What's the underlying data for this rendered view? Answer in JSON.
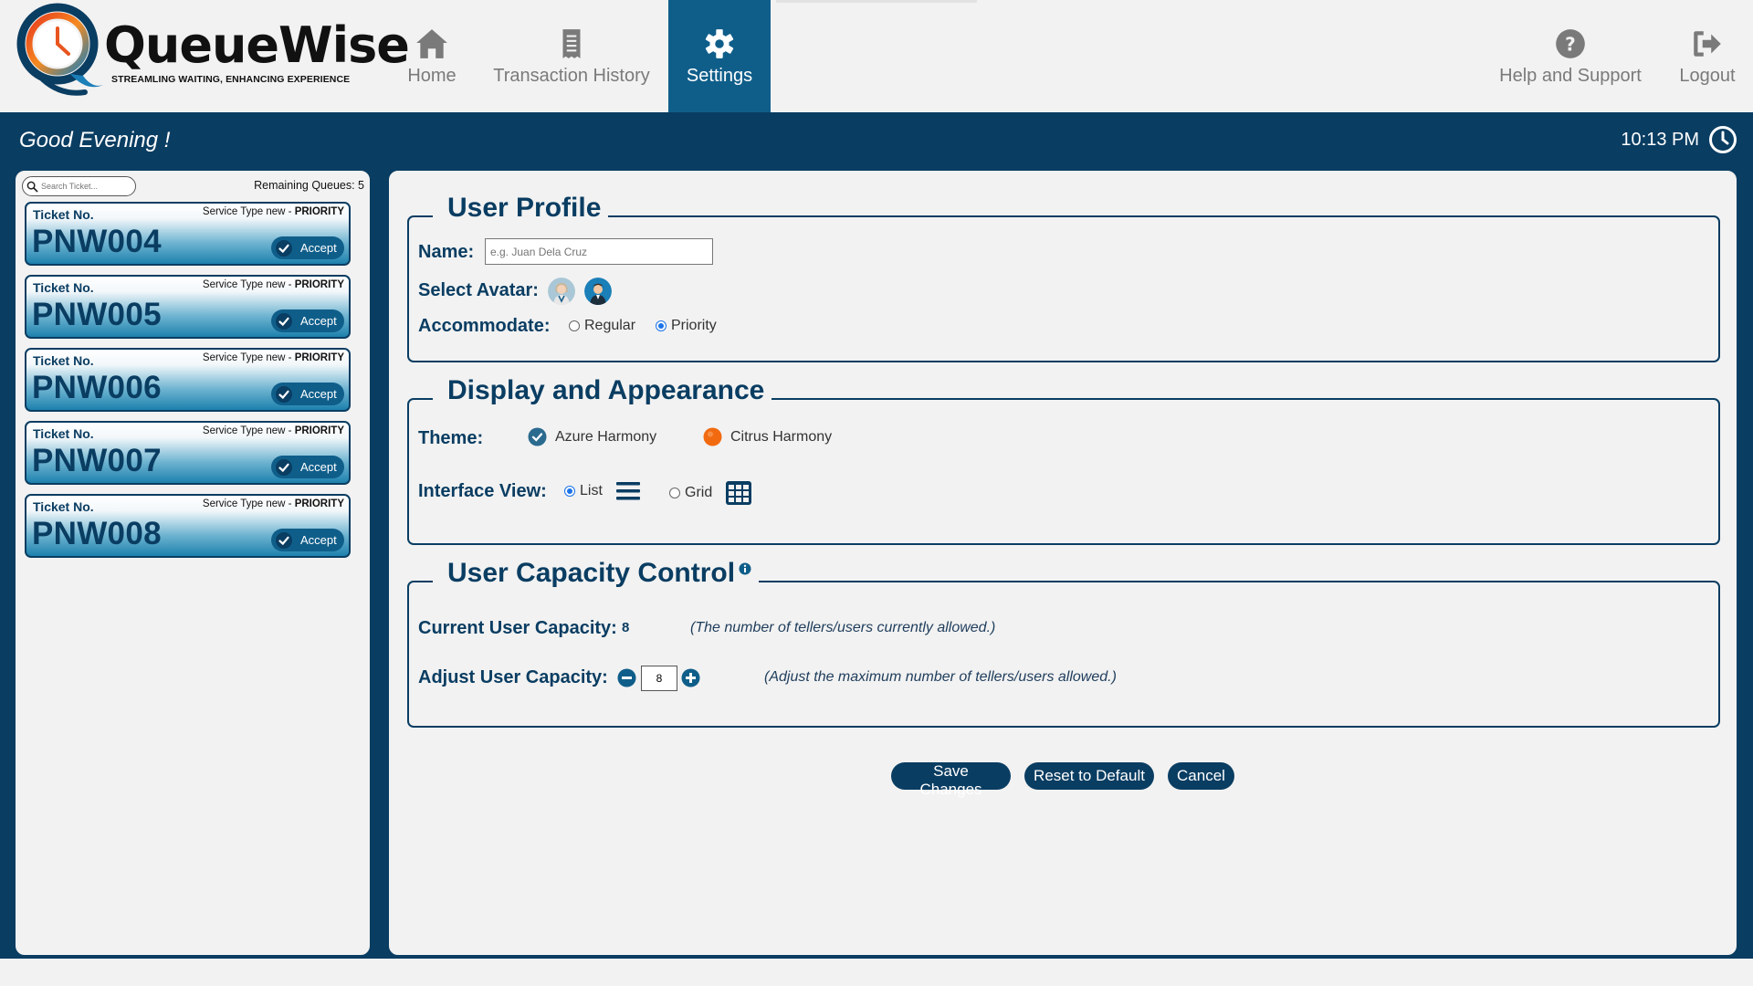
{
  "brand": {
    "name": "QueueWise",
    "tagline": "STREAMLING WAITING, ENHANCING EXPERIENCE"
  },
  "nav": {
    "home": "Home",
    "history": "Transaction History",
    "settings": "Settings",
    "help": "Help and Support",
    "logout": "Logout",
    "active": "Settings"
  },
  "header": {
    "greeting": "Good Evening !",
    "time": "10:13 PM"
  },
  "queue": {
    "search_placeholder": "Search Ticket...",
    "remaining": "Remaining Queues: 5",
    "tickets": [
      {
        "label": "Ticket No.",
        "service": "Service Type new - ",
        "priority": "PRIORITY",
        "number": "PNW004",
        "action": "Accept"
      },
      {
        "label": "Ticket No.",
        "service": "Service Type new - ",
        "priority": "PRIORITY",
        "number": "PNW005",
        "action": "Accept"
      },
      {
        "label": "Ticket No.",
        "service": "Service Type new - ",
        "priority": "PRIORITY",
        "number": "PNW006",
        "action": "Accept"
      },
      {
        "label": "Ticket No.",
        "service": "Service Type new - ",
        "priority": "PRIORITY",
        "number": "PNW007",
        "action": "Accept"
      },
      {
        "label": "Ticket No.",
        "service": "Service Type new - ",
        "priority": "PRIORITY",
        "number": "PNW008",
        "action": "Accept"
      }
    ]
  },
  "profile": {
    "title": "User Profile",
    "name_label": "Name:",
    "name_placeholder": "e.g. Juan Dela Cruz",
    "avatar_label": "Select Avatar:",
    "accommodate_label": "Accommodate:",
    "accommodate_options": [
      "Regular",
      "Priority"
    ],
    "accommodate_selected": "Priority"
  },
  "display": {
    "title": "Display and Appearance",
    "theme_label": "Theme:",
    "themes": [
      "Azure Harmony",
      "Citrus Harmony"
    ],
    "theme_selected": "Azure Harmony",
    "view_label": "Interface View:",
    "views": [
      "List",
      "Grid"
    ],
    "view_selected": "List"
  },
  "capacity": {
    "title": "User Capacity Control",
    "current_label": "Current User Capacity:",
    "current_value": "8",
    "current_note": "(The number of tellers/users currently allowed.)",
    "adjust_label": "Adjust User Capacity:",
    "adjust_value": "8",
    "adjust_note": "(Adjust the maximum number of tellers/users allowed.)"
  },
  "actions": {
    "save": "Save Changes",
    "reset": "Reset to Default",
    "cancel": "Cancel"
  },
  "colors": {
    "primary": "#0a3d62",
    "accent": "#0f5e8a",
    "citrus": "#f26a10"
  }
}
